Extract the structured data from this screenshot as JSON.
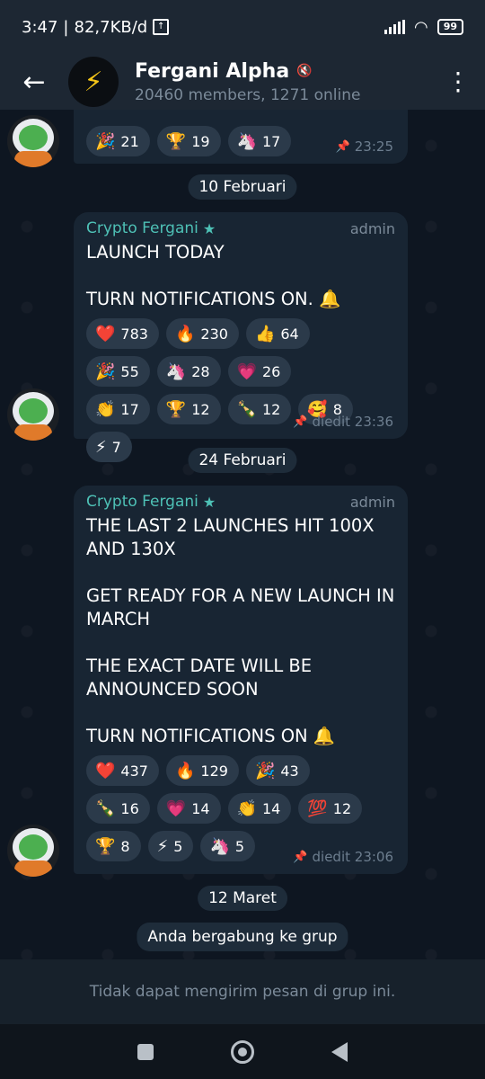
{
  "status": {
    "time": "3:47",
    "speed": "82,7KB/d",
    "battery": "99",
    "upload_icon": "upload-icon",
    "signal_icon": "signal-icon",
    "wifi_icon": "wifi-icon"
  },
  "header": {
    "title": "Fergani Alpha",
    "subtitle": "20460 members, 1271 online",
    "avatar_icon": "lightning-icon",
    "mute_icon": "mute-icon"
  },
  "messages": [
    {
      "partial": true,
      "reactions": [
        {
          "emoji": "🎉",
          "count": "21"
        },
        {
          "emoji": "🏆",
          "count": "19"
        },
        {
          "emoji": "🦄",
          "count": "17"
        }
      ],
      "time": "23:25"
    },
    {
      "date": "10 Februari",
      "sender": "Crypto Fergani",
      "role": "admin",
      "text": "LAUNCH TODAY\n\nTURN NOTIFICATIONS ON. 🔔",
      "reactions": [
        {
          "emoji": "❤️",
          "count": "783"
        },
        {
          "emoji": "🔥",
          "count": "230"
        },
        {
          "emoji": "👍",
          "count": "64"
        },
        {
          "emoji": "🎉",
          "count": "55"
        },
        {
          "emoji": "🦄",
          "count": "28"
        },
        {
          "emoji": "💗",
          "count": "26"
        },
        {
          "emoji": "👏",
          "count": "17"
        },
        {
          "emoji": "🏆",
          "count": "12"
        },
        {
          "emoji": "🍾",
          "count": "12"
        },
        {
          "emoji": "🥰",
          "count": "8"
        },
        {
          "emoji": "⚡",
          "count": "7"
        }
      ],
      "time": "diedit 23:36"
    },
    {
      "date": "24 Februari",
      "sender": "Crypto Fergani",
      "role": "admin",
      "text": "THE LAST 2 LAUNCHES HIT 100X AND 130X\n\nGET READY FOR A NEW LAUNCH IN MARCH\n\nTHE EXACT DATE WILL BE ANNOUNCED SOON\n\nTURN NOTIFICATIONS ON 🔔",
      "reactions": [
        {
          "emoji": "❤️",
          "count": "437"
        },
        {
          "emoji": "🔥",
          "count": "129"
        },
        {
          "emoji": "🎉",
          "count": "43"
        },
        {
          "emoji": "🍾",
          "count": "16"
        },
        {
          "emoji": "💗",
          "count": "14"
        },
        {
          "emoji": "👏",
          "count": "14"
        },
        {
          "emoji": "💯",
          "count": "12"
        },
        {
          "emoji": "🏆",
          "count": "8"
        },
        {
          "emoji": "⚡",
          "count": "5"
        },
        {
          "emoji": "🦄",
          "count": "5"
        }
      ],
      "time": "diedit 23:06"
    }
  ],
  "date_last": "12 Maret",
  "service_message": "Anda bergabung ke grup",
  "bottom_notice": "Tidak dapat mengirim pesan di grup ini.",
  "colors": {
    "accent": "#4ec1b6",
    "bubble": "#182533",
    "background": "#0e1621"
  }
}
